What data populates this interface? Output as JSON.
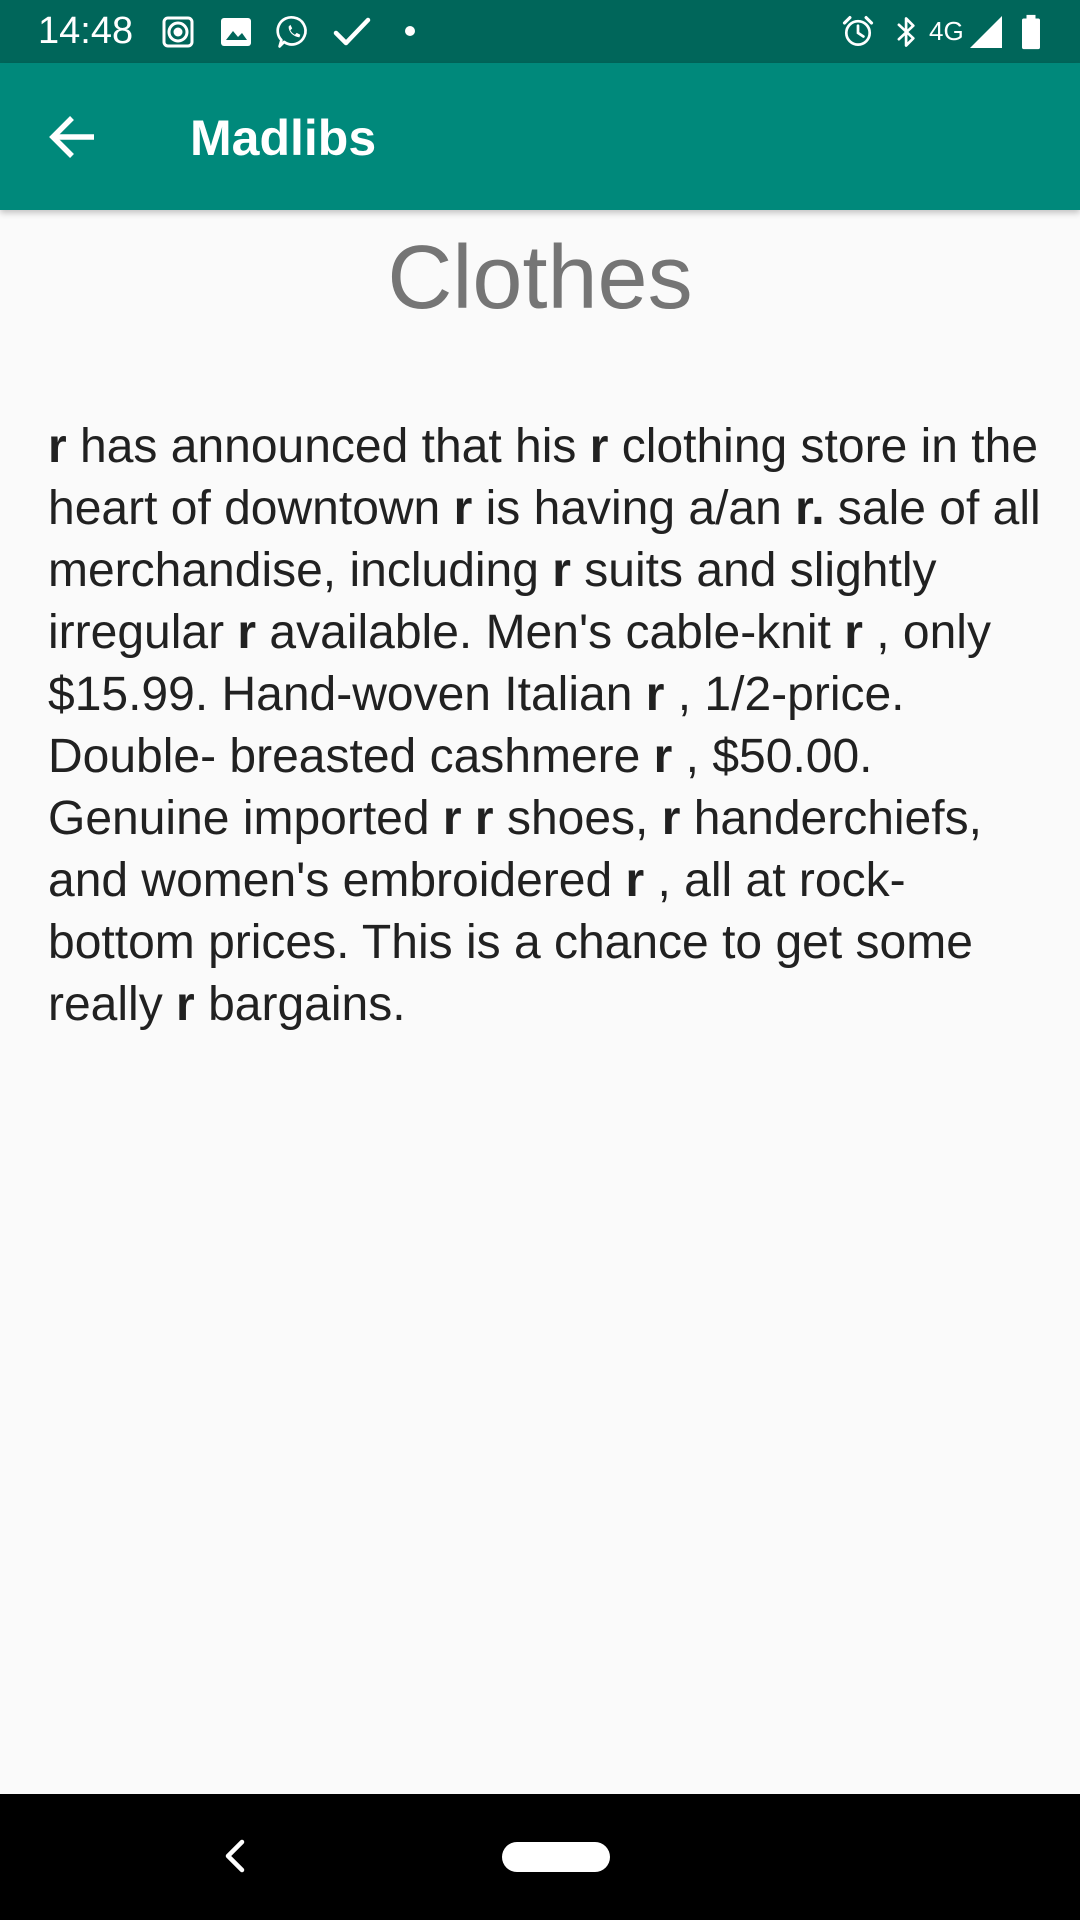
{
  "status_bar": {
    "time": "14:48",
    "network_label": "4G",
    "left_icons": [
      "screen-record-icon",
      "image-icon",
      "whatsapp-icon",
      "check-icon",
      "dot-icon"
    ],
    "right_icons": [
      "alarm-icon",
      "bluetooth-icon",
      "signal-icon",
      "battery-icon"
    ]
  },
  "app_bar": {
    "title": "Madlibs",
    "back_icon": "arrow-left-icon",
    "color": "#00897b"
  },
  "story": {
    "title": "Clothes",
    "segments": [
      {
        "t": "r",
        "b": true
      },
      {
        "t": " has announced that his ",
        "b": false
      },
      {
        "t": "r",
        "b": true
      },
      {
        "t": " clothing store in the heart of downtown ",
        "b": false
      },
      {
        "t": "r",
        "b": true
      },
      {
        "t": " is having a/an ",
        "b": false
      },
      {
        "t": "r.",
        "b": true
      },
      {
        "t": " sale of all merchandise, including ",
        "b": false
      },
      {
        "t": "r",
        "b": true
      },
      {
        "t": " suits and slightly irregular ",
        "b": false
      },
      {
        "t": "r",
        "b": true
      },
      {
        "t": " available. Men's cable-knit ",
        "b": false
      },
      {
        "t": "r",
        "b": true
      },
      {
        "t": " , only $15.99. Hand-woven Italian ",
        "b": false
      },
      {
        "t": "r",
        "b": true
      },
      {
        "t": " , 1/2-price. Double- breasted cashmere ",
        "b": false
      },
      {
        "t": "r",
        "b": true
      },
      {
        "t": " , $50.00. Genuine imported ",
        "b": false
      },
      {
        "t": "r r",
        "b": true
      },
      {
        "t": " shoes, ",
        "b": false
      },
      {
        "t": "r",
        "b": true
      },
      {
        "t": " handerchiefs, and women's embroidered ",
        "b": false
      },
      {
        "t": "r",
        "b": true
      },
      {
        "t": " , all at rock-bottom prices. This is a chance to get some really ",
        "b": false
      },
      {
        "t": "r",
        "b": true
      },
      {
        "t": " bargains.",
        "b": false
      }
    ]
  },
  "nav_bar": {
    "icons": [
      "nav-back-icon",
      "nav-home-pill-icon"
    ]
  }
}
